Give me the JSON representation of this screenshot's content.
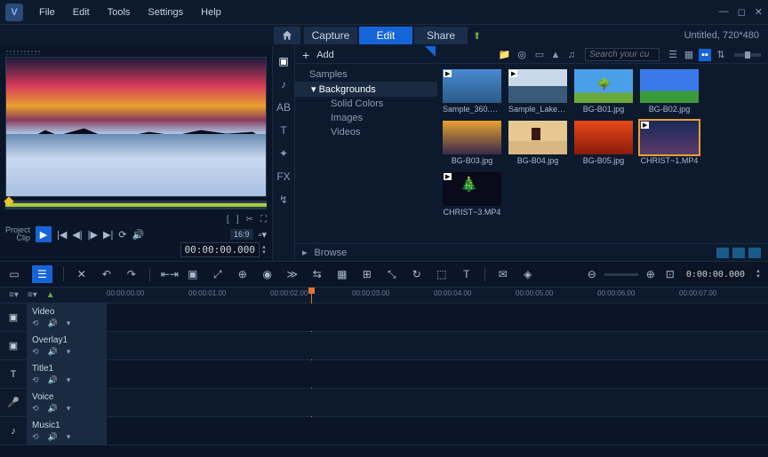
{
  "menu": {
    "file": "File",
    "edit": "Edit",
    "tools": "Tools",
    "settings": "Settings",
    "help": "Help"
  },
  "modes": {
    "capture": "Capture",
    "edit": "Edit",
    "share": "Share"
  },
  "project": {
    "title": "Untitled, 720*480"
  },
  "preview": {
    "label_project": "Project",
    "label_clip": "Clip",
    "timecode": "00:00:00.000",
    "aspect": "16:9"
  },
  "library": {
    "add": "Add",
    "search_placeholder": "Search your cu",
    "tree": {
      "samples": "Samples",
      "backgrounds": "Backgrounds",
      "solid": "Solid Colors",
      "images": "Images",
      "videos": "Videos"
    },
    "items": [
      {
        "label": "Sample_360.mp4",
        "cls": "bg-360",
        "vid": true
      },
      {
        "label": "Sample_Lake.m...",
        "cls": "bg-lake",
        "vid": true
      },
      {
        "label": "BG-B01.jpg",
        "cls": "bg-b01"
      },
      {
        "label": "BG-B02.jpg",
        "cls": "bg-b02"
      },
      {
        "label": "BG-B03.jpg",
        "cls": "bg-b03"
      },
      {
        "label": "BG-B04.jpg",
        "cls": "bg-b04"
      },
      {
        "label": "BG-B05.jpg",
        "cls": "bg-b05"
      },
      {
        "label": "CHRIST~1.MP4",
        "cls": "bg-chr1",
        "vid": true,
        "selected": true
      },
      {
        "label": "CHRIST~3.MP4",
        "cls": "bg-chr3",
        "vid": true
      }
    ],
    "browse": "Browse"
  },
  "timeline": {
    "timecode": "0:00:00.000",
    "ruler": [
      "00:00:00.00",
      "00:00:01.00",
      "00:00:02.00",
      "00:00:03.00",
      "00:00:04.00",
      "00:00:05.00",
      "00:00:06.00",
      "00:00:07.00"
    ],
    "tracks": [
      {
        "name": "Video",
        "type": "video"
      },
      {
        "name": "Overlay1",
        "type": "overlay"
      },
      {
        "name": "Title1",
        "type": "title"
      },
      {
        "name": "Voice",
        "type": "voice"
      },
      {
        "name": "Music1",
        "type": "music"
      }
    ]
  }
}
